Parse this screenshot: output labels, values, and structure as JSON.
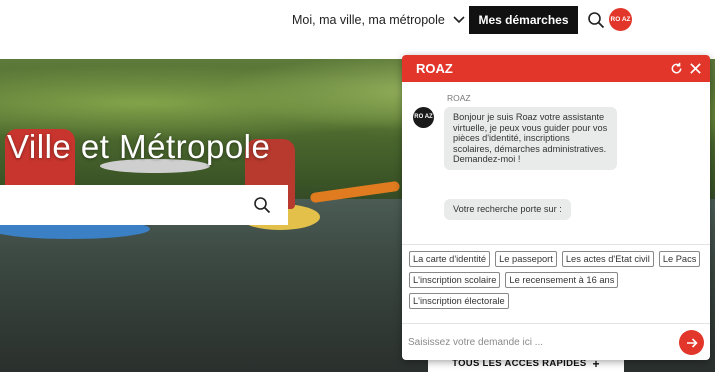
{
  "header": {
    "dropdown_label": "Moi, ma ville, ma métropole",
    "cta_label": "Mes démarches",
    "logo_text": "RO AZ",
    "search_icon": "search-icon"
  },
  "hero": {
    "title": "Ville et Métropole",
    "search_placeholder": "",
    "quick_access_label": "TOUS LES ACCÈS RAPIDES",
    "quick_access_icon": "+"
  },
  "chat": {
    "title": "ROAZ",
    "avatar_text": "RO AZ",
    "sender": "ROAZ",
    "messages": [
      "Bonjour je suis Roaz votre assistante virtuelle, je peux vous guider pour vos pièces d'identité, inscriptions scolaires, démarches administratives. Demandez-moi !",
      "Votre recherche porte sur :"
    ],
    "chips": [
      "La carte d'identité",
      "Le passeport",
      "Les actes d'Etat civil",
      "Le Pacs",
      "L'inscription scolaire",
      "Le recensement à 16 ans",
      "L'inscription électorale"
    ],
    "input_placeholder": "Saisissez votre demande ici ...",
    "colors": {
      "accent": "#e2362a",
      "bubble": "#e9ebeb"
    }
  }
}
